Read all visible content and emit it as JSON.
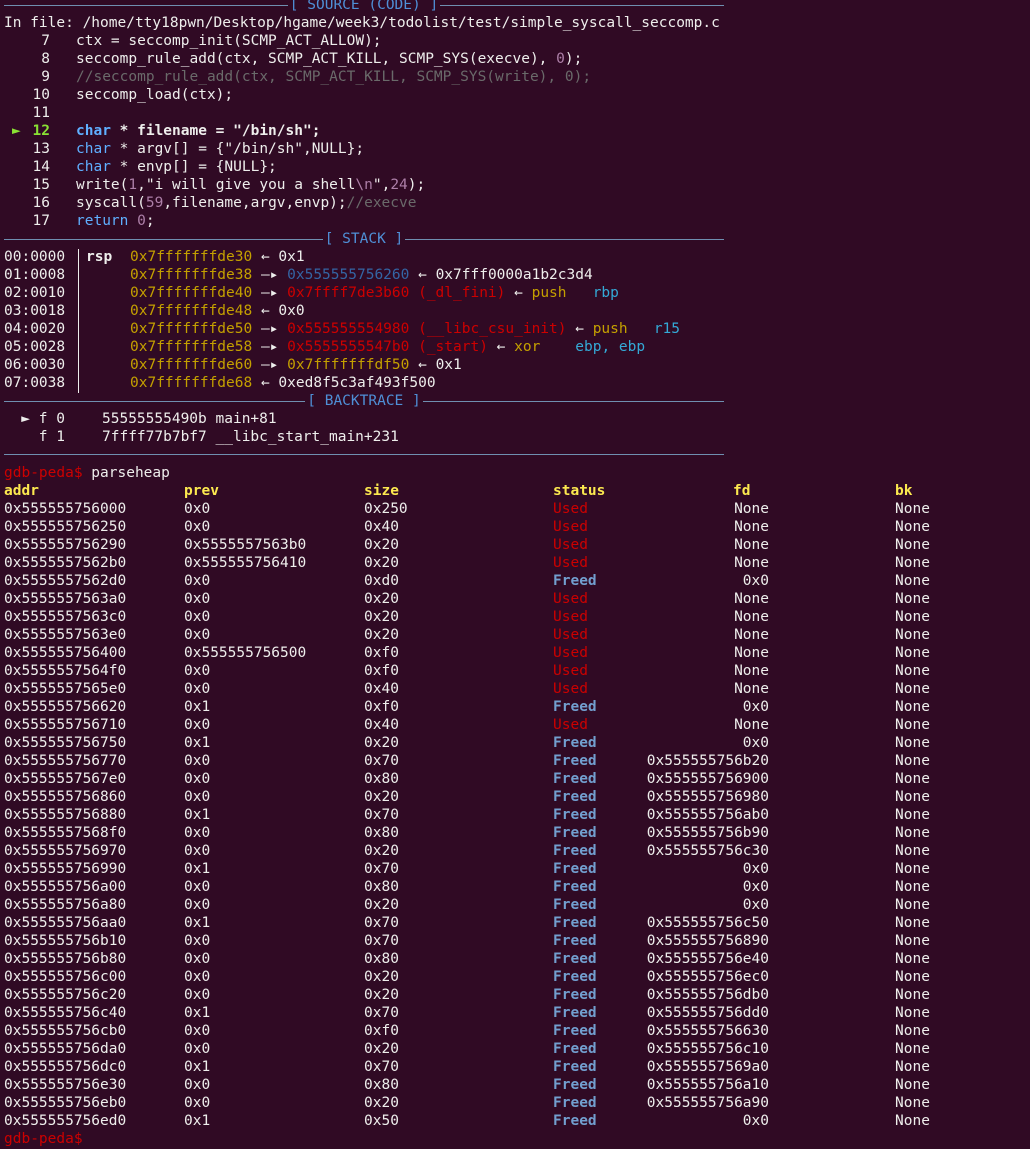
{
  "source": {
    "header": "[ SOURCE (CODE) ]",
    "file_line": "In file: /home/tty18pwn/Desktop/hgame/week3/todolist/test/simple_syscall_seccomp.c",
    "line_numbers": [
      "7",
      "8",
      "9",
      "10",
      "11",
      "12",
      "13",
      "14",
      "15",
      "16",
      "17"
    ],
    "current_marker": "►",
    "lines": {
      "l7": "ctx = seccomp_init(SCMP_ACT_ALLOW);",
      "l8a": "seccomp_rule_add(ctx, SCMP_ACT_KILL, SCMP_SYS(execve), ",
      "l8n": "0",
      "l8b": ");",
      "l9": "//seccomp_rule_add(ctx, SCMP_ACT_KILL, SCMP_SYS(write), 0);",
      "l10": "seccomp_load(ctx);",
      "l12k": "char",
      "l12": " * filename = \"/bin/sh\";",
      "l13k": "char",
      "l13": " * argv[] = {\"/bin/sh\",NULL};",
      "l14k": "char",
      "l14": " * envp[] = {NULL};",
      "l15a": "write(",
      "l15n1": "1",
      "l15b": ",\"i will give you a shell",
      "l15esc": "\\n",
      "l15c": "\",",
      "l15n2": "24",
      "l15d": ");",
      "l16a": "syscall(",
      "l16n": "59",
      "l16b": ",filename,argv,envp);",
      "l16c": "//execve",
      "l17k": "return",
      "l17n": "0",
      "l17b": ";"
    }
  },
  "stack": {
    "header": "[ STACK ]",
    "rows": [
      {
        "off": "00:0000",
        "reg": "rsp",
        "addr": "0x7fffffffde30",
        "arrow": "←",
        "val": "0x1"
      },
      {
        "off": "01:0008",
        "reg": "",
        "addr": "0x7fffffffde38",
        "arrow": "—▸",
        "val": "0x555555756260",
        "arrow2": "←",
        "val2": "0x7fff0000a1b2c3d4"
      },
      {
        "off": "02:0010",
        "reg": "",
        "addr": "0x7fffffffde40",
        "arrow": "—▸",
        "val": "0x7ffff7de3b60 (_dl_fini)",
        "arrow2": "←",
        "val2": "push   ",
        "val3": "rbp"
      },
      {
        "off": "03:0018",
        "reg": "",
        "addr": "0x7fffffffde48",
        "arrow": "←",
        "val": "0x0"
      },
      {
        "off": "04:0020",
        "reg": "",
        "addr": "0x7fffffffde50",
        "arrow": "—▸",
        "val": "0x555555554980 (__libc_csu_init)",
        "arrow2": "←",
        "val2": "push   ",
        "val3": "r15"
      },
      {
        "off": "05:0028",
        "reg": "",
        "addr": "0x7fffffffde58",
        "arrow": "—▸",
        "val": "0x5555555547b0 (_start)",
        "arrow2": "←",
        "val2": "xor    ",
        "val3": "ebp, ebp"
      },
      {
        "off": "06:0030",
        "reg": "",
        "addr": "0x7fffffffde60",
        "arrow": "—▸",
        "val": "0x7fffffffdf50",
        "arrow2": "←",
        "val2": "0x1"
      },
      {
        "off": "07:0038",
        "reg": "",
        "addr": "0x7fffffffde68",
        "arrow": "←",
        "val": "0xed8f5c3af493f500"
      }
    ]
  },
  "backtrace": {
    "header": "[ BACKTRACE ]",
    "frames": [
      {
        "marker": "►",
        "frame": "f 0",
        "addr": "55555555490b",
        "sym": "main+81"
      },
      {
        "marker": "",
        "frame": "f 1",
        "addr": "7ffff77b7bf7",
        "sym": "__libc_start_main+231"
      }
    ]
  },
  "prompt": "gdb-peda$",
  "command": " parseheap",
  "heap": {
    "columns": [
      "addr",
      "prev",
      "size",
      "status",
      "fd",
      "bk"
    ],
    "rows": [
      [
        "0x555555756000",
        "0x0",
        "0x250",
        "Used",
        "None",
        "None"
      ],
      [
        "0x555555756250",
        "0x0",
        "0x40",
        "Used",
        "None",
        "None"
      ],
      [
        "0x555555756290",
        "0x5555557563b0",
        "0x20",
        "Used",
        "None",
        "None"
      ],
      [
        "0x5555557562b0",
        "0x555555756410",
        "0x20",
        "Used",
        "None",
        "None"
      ],
      [
        "0x5555557562d0",
        "0x0",
        "0xd0",
        "Freed",
        "0x0",
        "None"
      ],
      [
        "0x5555557563a0",
        "0x0",
        "0x20",
        "Used",
        "None",
        "None"
      ],
      [
        "0x5555557563c0",
        "0x0",
        "0x20",
        "Used",
        "None",
        "None"
      ],
      [
        "0x5555557563e0",
        "0x0",
        "0x20",
        "Used",
        "None",
        "None"
      ],
      [
        "0x555555756400",
        "0x555555756500",
        "0xf0",
        "Used",
        "None",
        "None"
      ],
      [
        "0x5555557564f0",
        "0x0",
        "0xf0",
        "Used",
        "None",
        "None"
      ],
      [
        "0x5555557565e0",
        "0x0",
        "0x40",
        "Used",
        "None",
        "None"
      ],
      [
        "0x555555756620",
        "0x1",
        "0xf0",
        "Freed",
        "0x0",
        "None"
      ],
      [
        "0x555555756710",
        "0x0",
        "0x40",
        "Used",
        "None",
        "None"
      ],
      [
        "0x555555756750",
        "0x1",
        "0x20",
        "Freed",
        "0x0",
        "None"
      ],
      [
        "0x555555756770",
        "0x0",
        "0x70",
        "Freed",
        "0x555555756b20",
        "None"
      ],
      [
        "0x5555557567e0",
        "0x0",
        "0x80",
        "Freed",
        "0x555555756900",
        "None"
      ],
      [
        "0x555555756860",
        "0x0",
        "0x20",
        "Freed",
        "0x555555756980",
        "None"
      ],
      [
        "0x555555756880",
        "0x1",
        "0x70",
        "Freed",
        "0x555555756ab0",
        "None"
      ],
      [
        "0x5555557568f0",
        "0x0",
        "0x80",
        "Freed",
        "0x555555756b90",
        "None"
      ],
      [
        "0x555555756970",
        "0x0",
        "0x20",
        "Freed",
        "0x555555756c30",
        "None"
      ],
      [
        "0x555555756990",
        "0x1",
        "0x70",
        "Freed",
        "0x0",
        "None"
      ],
      [
        "0x555555756a00",
        "0x0",
        "0x80",
        "Freed",
        "0x0",
        "None"
      ],
      [
        "0x555555756a80",
        "0x0",
        "0x20",
        "Freed",
        "0x0",
        "None"
      ],
      [
        "0x555555756aa0",
        "0x1",
        "0x70",
        "Freed",
        "0x555555756c50",
        "None"
      ],
      [
        "0x555555756b10",
        "0x0",
        "0x70",
        "Freed",
        "0x555555756890",
        "None"
      ],
      [
        "0x555555756b80",
        "0x0",
        "0x80",
        "Freed",
        "0x555555756e40",
        "None"
      ],
      [
        "0x555555756c00",
        "0x0",
        "0x20",
        "Freed",
        "0x555555756ec0",
        "None"
      ],
      [
        "0x555555756c20",
        "0x0",
        "0x20",
        "Freed",
        "0x555555756db0",
        "None"
      ],
      [
        "0x555555756c40",
        "0x1",
        "0x70",
        "Freed",
        "0x555555756dd0",
        "None"
      ],
      [
        "0x555555756cb0",
        "0x0",
        "0xf0",
        "Freed",
        "0x555555756630",
        "None"
      ],
      [
        "0x555555756da0",
        "0x0",
        "0x20",
        "Freed",
        "0x555555756c10",
        "None"
      ],
      [
        "0x555555756dc0",
        "0x1",
        "0x70",
        "Freed",
        "0x5555557569a0",
        "None"
      ],
      [
        "0x555555756e30",
        "0x0",
        "0x80",
        "Freed",
        "0x555555756a10",
        "None"
      ],
      [
        "0x555555756eb0",
        "0x0",
        "0x20",
        "Freed",
        "0x555555756a90",
        "None"
      ],
      [
        "0x555555756ed0",
        "0x1",
        "0x50",
        "Freed",
        "0x0",
        "None"
      ]
    ]
  },
  "colors": {
    "background": "#300a24",
    "used": "#cc0000",
    "freed": "#729fcf",
    "header": "#fce94f"
  }
}
